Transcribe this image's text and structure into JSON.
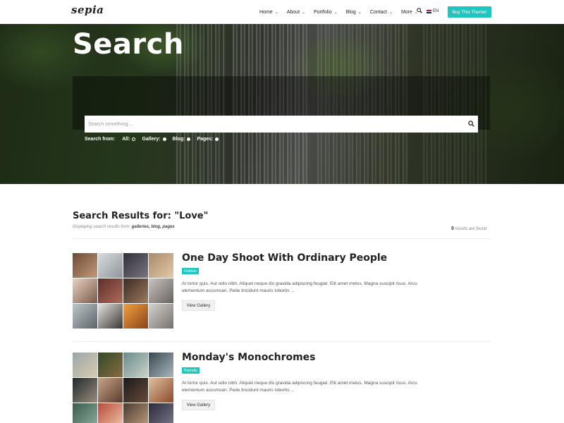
{
  "header": {
    "logo": "sepia",
    "nav": [
      {
        "label": "Home"
      },
      {
        "label": "About"
      },
      {
        "label": "Portfolio"
      },
      {
        "label": "Blog"
      },
      {
        "label": "Contact"
      },
      {
        "label": "More"
      }
    ],
    "search_icon": "search-icon",
    "language": "EN",
    "buy_button": "Buy This Theme!"
  },
  "hero": {
    "title": "Search",
    "search_placeholder": "Search something ...",
    "search_from_label": "Search from:",
    "options": [
      {
        "label": "All:",
        "selected": true
      },
      {
        "label": "Gallery:",
        "selected": false
      },
      {
        "label": "Blog:",
        "selected": false
      },
      {
        "label": "Pages:",
        "selected": false
      }
    ]
  },
  "results": {
    "title": "Search Results for: \"Love\"",
    "displaying_prefix": "Displaying search results from:",
    "displaying_sources": "galleries, blog, pages",
    "count": "9",
    "count_suffix": "results are found",
    "items": [
      {
        "title": "One Day Shoot With Ordinary People",
        "tag": "Outdoor",
        "excerpt": "At tortor quis. Aut odio nibh. Aliquet neque dis gravida adipiscing feugiat. Elit amet metus. Magna suscipit risus. Arcu elementum accumsan. Pede tincidunt mauris lobortis ...",
        "button": "View Gallery"
      },
      {
        "title": "Monday's Monochromes",
        "tag": "Portraits",
        "excerpt": "At tortor quis. Aut odio nibh. Aliquet neque dis gravida adipiscing feugiat. Elit amet metus. Magna suscipit risus. Arcu elementum accumsan. Pede tincidunt mauris lobortis ...",
        "button": "View Gallery"
      }
    ]
  },
  "colors": {
    "accent": "#1fc6bf",
    "text": "#222222",
    "muted": "#888888"
  }
}
